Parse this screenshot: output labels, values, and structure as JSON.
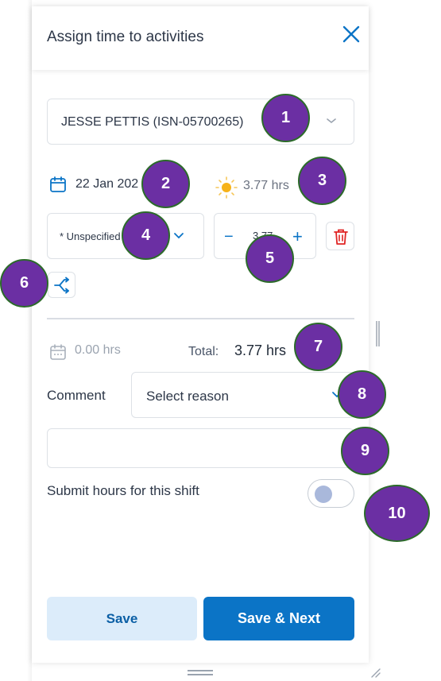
{
  "panel": {
    "title": "Assign time to activities"
  },
  "employee": {
    "selected": "JESSE PETTIS (ISN-05700265)"
  },
  "shift": {
    "date": "22 Jan 202",
    "day_hours": "3.77 hrs"
  },
  "activity": {
    "selected": "* Unspecified",
    "hours_value": "3.77"
  },
  "summary": {
    "unassigned_hours": "0.00 hrs",
    "total_label": "Total:",
    "total_value": "3.77 hrs"
  },
  "comment": {
    "label": "Comment",
    "reason_placeholder": "Select reason",
    "text_value": ""
  },
  "submit": {
    "label": "Submit hours for this shift",
    "toggle_on": false
  },
  "buttons": {
    "save": "Save",
    "save_next": "Save & Next"
  },
  "callouts": [
    "1",
    "2",
    "3",
    "4",
    "5",
    "6",
    "7",
    "8",
    "9",
    "10"
  ],
  "colors": {
    "accent": "#0b74c6",
    "danger": "#e02424",
    "callout_fill": "#6b2fa3",
    "callout_border": "#2c6b2a"
  }
}
